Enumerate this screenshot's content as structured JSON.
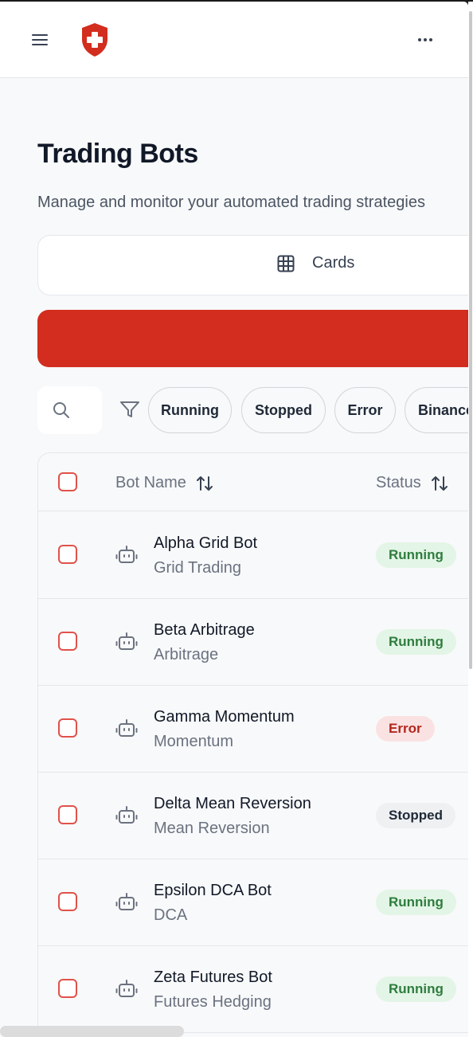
{
  "header": {
    "menu_icon": "hamburger-menu-icon",
    "logo_icon": "shield-cross-logo",
    "more_icon": "more-horizontal-icon"
  },
  "page": {
    "title": "Trading Bots",
    "subtitle": "Manage and monitor your automated trading strategies"
  },
  "view_toggle": {
    "label": "Cards",
    "icon": "grid-icon"
  },
  "colors": {
    "brand": "#d22d1e",
    "checkbox_border": "#e0524a",
    "running_bg": "#e3f5e6",
    "running_text": "#2e7d3e",
    "error_bg": "#fbe2e2",
    "error_text": "#b3261e",
    "stopped_bg": "#eef0f2"
  },
  "filters": {
    "search_icon": "search-icon",
    "filter_icon": "filter-icon",
    "chips": [
      "Running",
      "Stopped",
      "Error",
      "Binance"
    ]
  },
  "table": {
    "columns": [
      {
        "label": "Bot Name",
        "sort_icon": "sort-arrows-icon"
      },
      {
        "label": "Status",
        "sort_icon": "sort-arrows-icon"
      }
    ],
    "rows": [
      {
        "name": "Alpha Grid Bot",
        "type": "Grid Trading",
        "status": "Running"
      },
      {
        "name": "Beta Arbitrage",
        "type": "Arbitrage",
        "status": "Running"
      },
      {
        "name": "Gamma Momentum",
        "type": "Momentum",
        "status": "Error"
      },
      {
        "name": "Delta Mean Reversion",
        "type": "Mean Reversion",
        "status": "Stopped"
      },
      {
        "name": "Epsilon DCA Bot",
        "type": "DCA",
        "status": "Running"
      },
      {
        "name": "Zeta Futures Bot",
        "type": "Futures Hedging",
        "status": "Running"
      }
    ]
  }
}
